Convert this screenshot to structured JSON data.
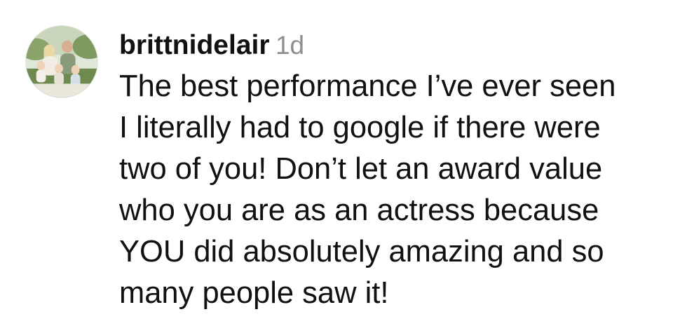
{
  "comment": {
    "username": "brittnidelair",
    "timestamp": "1d",
    "avatar": {
      "icon": "family-photo-avatar",
      "description_colors": {
        "sky": "#dfe7d8",
        "grass": "#6f8a4f",
        "ring": "#e6e6e6"
      }
    },
    "text_lines": [
      "The best performance I’ve ever seen",
      "I literally had to google if there were",
      "two of you! Don’t let an award value",
      "who you are as an actress because",
      "YOU did absolutely amazing and so",
      "many people saw it!"
    ]
  },
  "colors": {
    "text": "#111111",
    "muted": "#8e8e8e",
    "background": "#ffffff"
  }
}
